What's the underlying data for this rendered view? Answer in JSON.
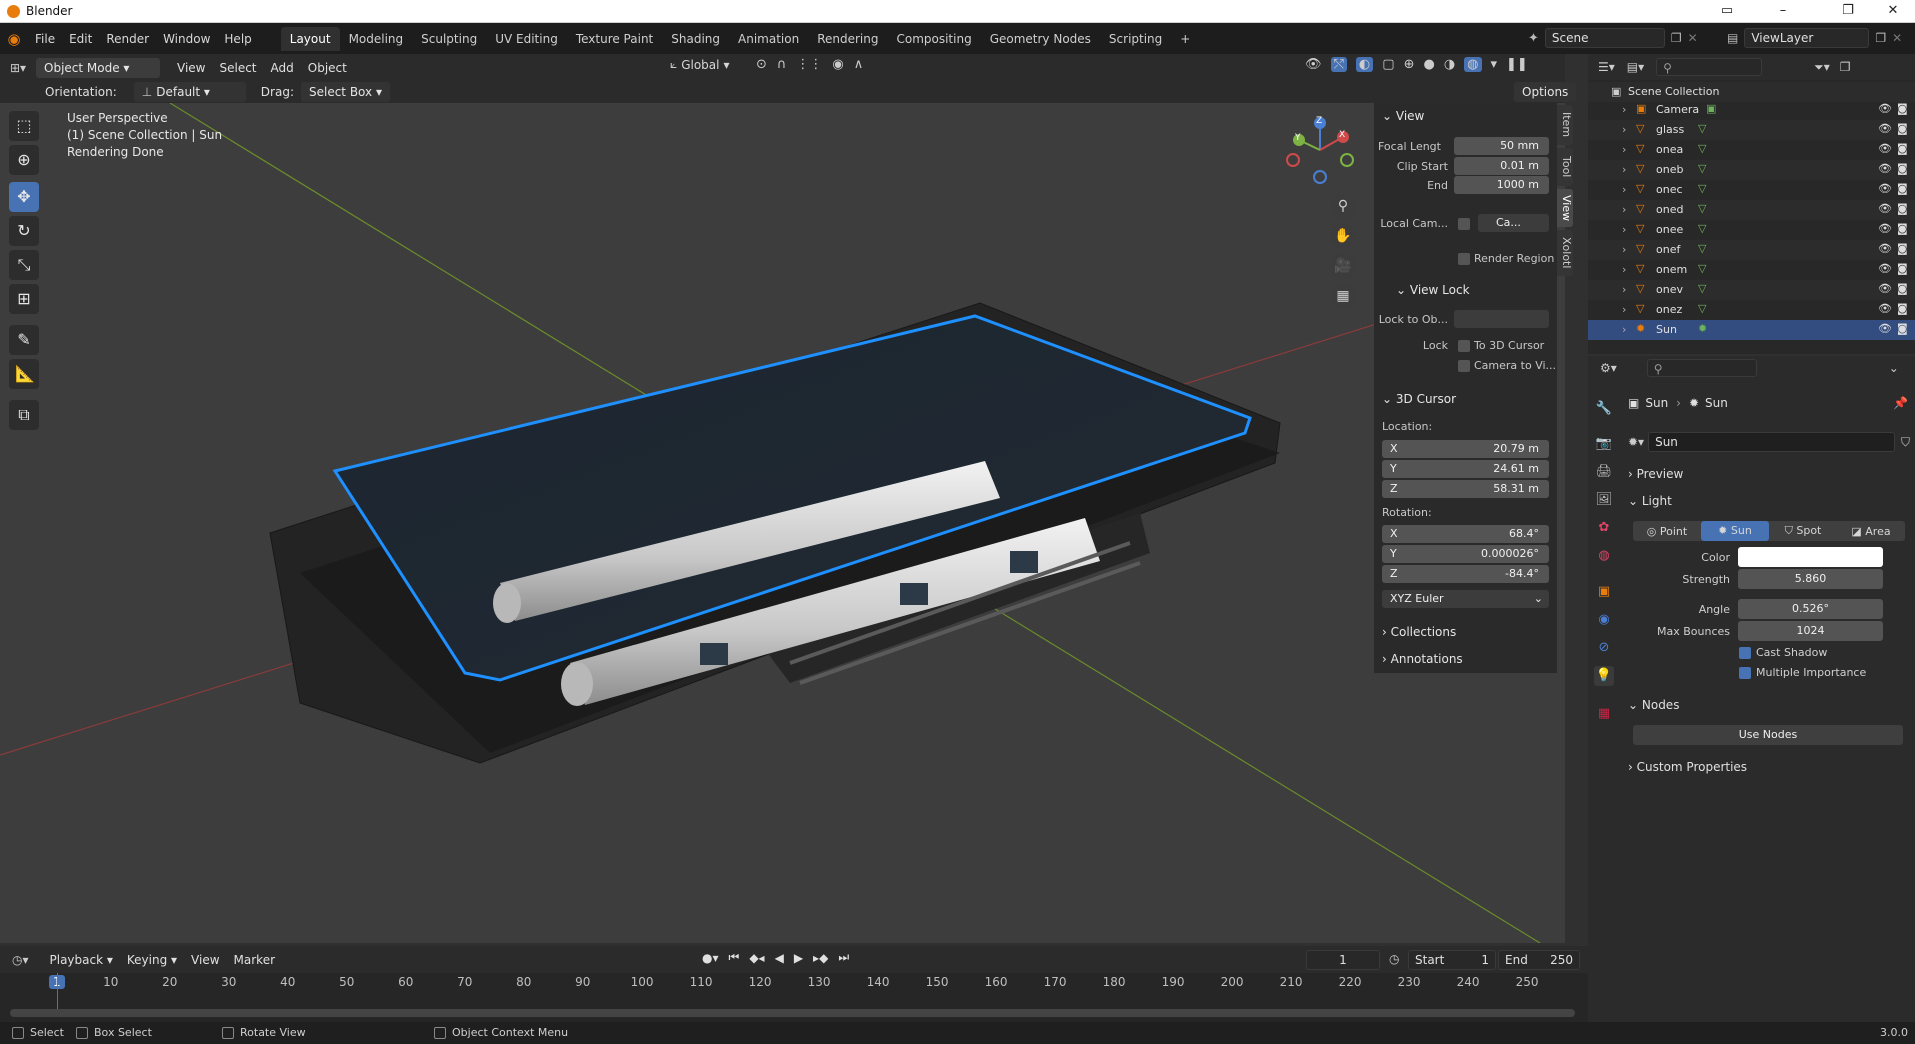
{
  "window": {
    "title": "Blender",
    "minimize": "–",
    "maximize": "❐",
    "close": "✕"
  },
  "menu": [
    "File",
    "Edit",
    "Render",
    "Window",
    "Help"
  ],
  "workspaces": [
    "Layout",
    "Modeling",
    "Sculpting",
    "UV Editing",
    "Texture Paint",
    "Shading",
    "Animation",
    "Rendering",
    "Compositing",
    "Geometry Nodes",
    "Scripting",
    "+"
  ],
  "scene": {
    "label": "Scene",
    "view_layer": "ViewLayer"
  },
  "header": {
    "mode": "Object Mode",
    "menus": [
      "View",
      "Select",
      "Add",
      "Object"
    ],
    "transform_orientation": "Global",
    "orientation_label": "Orientation:",
    "orientation_value": "Default",
    "drag_label": "Drag:",
    "drag_value": "Select Box",
    "options": "Options"
  },
  "viewport": {
    "line1": "User Perspective",
    "line2": "(1) Scene Collection | Sun",
    "line3": "Rendering Done",
    "gizmo": {
      "x": "X",
      "y": "Y",
      "z": "Z"
    }
  },
  "npanel": {
    "tabs": [
      "Item",
      "Tool",
      "View",
      "Xolotl"
    ],
    "view_title": "View",
    "focal_label": "Focal Lengt",
    "focal_value": "50 mm",
    "clip_start_label": "Clip Start",
    "clip_start_value": "0.01 m",
    "clip_end_label": "End",
    "clip_end_value": "1000 m",
    "local_cam_label": "Local Cam...",
    "local_cam_value": "Ca...",
    "render_region": "Render Region",
    "view_lock_title": "View Lock",
    "lock_to_ob_label": "Lock to Ob...",
    "lock_label": "Lock",
    "lock_cursor": "To 3D Cursor",
    "camera_to_view": "Camera to Vi...",
    "cursor_title": "3D Cursor",
    "location_label": "Location:",
    "loc_x": "20.79 m",
    "loc_y": "24.61 m",
    "loc_z": "58.31 m",
    "rotation_label": "Rotation:",
    "rot_x": "68.4°",
    "rot_y": "0.000026°",
    "rot_z": "-84.4°",
    "rot_mode": "XYZ Euler",
    "collections": "Collections",
    "annotations": "Annotations",
    "x": "X",
    "y": "Y",
    "z": "Z"
  },
  "outliner": {
    "root": "Scene Collection",
    "items": [
      "Camera",
      "glass",
      "onea",
      "oneb",
      "onec",
      "oned",
      "onee",
      "onef",
      "onem",
      "onev",
      "onez",
      "Sun"
    ],
    "selected": "Sun"
  },
  "properties": {
    "breadcrumb_obj": "Sun",
    "breadcrumb_data": "Sun",
    "datablock": "Sun",
    "preview": "Preview",
    "light": "Light",
    "light_types": [
      "Point",
      "Sun",
      "Spot",
      "Area"
    ],
    "active_type": "Sun",
    "color_label": "Color",
    "color_value": "#ffffff",
    "strength_label": "Strength",
    "strength_value": "5.860",
    "angle_label": "Angle",
    "angle_value": "0.526°",
    "bounces_label": "Max Bounces",
    "bounces_value": "1024",
    "cast_shadow": "Cast Shadow",
    "multiple_importance": "Multiple Importance",
    "nodes": "Nodes",
    "use_nodes": "Use Nodes",
    "custom_props": "Custom Properties"
  },
  "timeline": {
    "menus": [
      "Playback",
      "Keying",
      "View",
      "Marker"
    ],
    "current_frame": "1",
    "start_label": "Start",
    "start_value": "1",
    "end_label": "End",
    "end_value": "250",
    "ticks": [
      "1",
      "10",
      "20",
      "30",
      "40",
      "50",
      "60",
      "70",
      "80",
      "90",
      "100",
      "110",
      "120",
      "130",
      "140",
      "150",
      "160",
      "170",
      "180",
      "190",
      "200",
      "210",
      "220",
      "230",
      "240",
      "250"
    ]
  },
  "status": {
    "select": "Select",
    "box_select": "Box Select",
    "rotate_view": "Rotate View",
    "context_menu": "Object Context Menu",
    "version": "3.0.0"
  },
  "colors": {
    "accent": "#4772b3",
    "selected_row": "#334d80",
    "brand": "#e87d0d",
    "glass_edge": "#1e90ff"
  }
}
